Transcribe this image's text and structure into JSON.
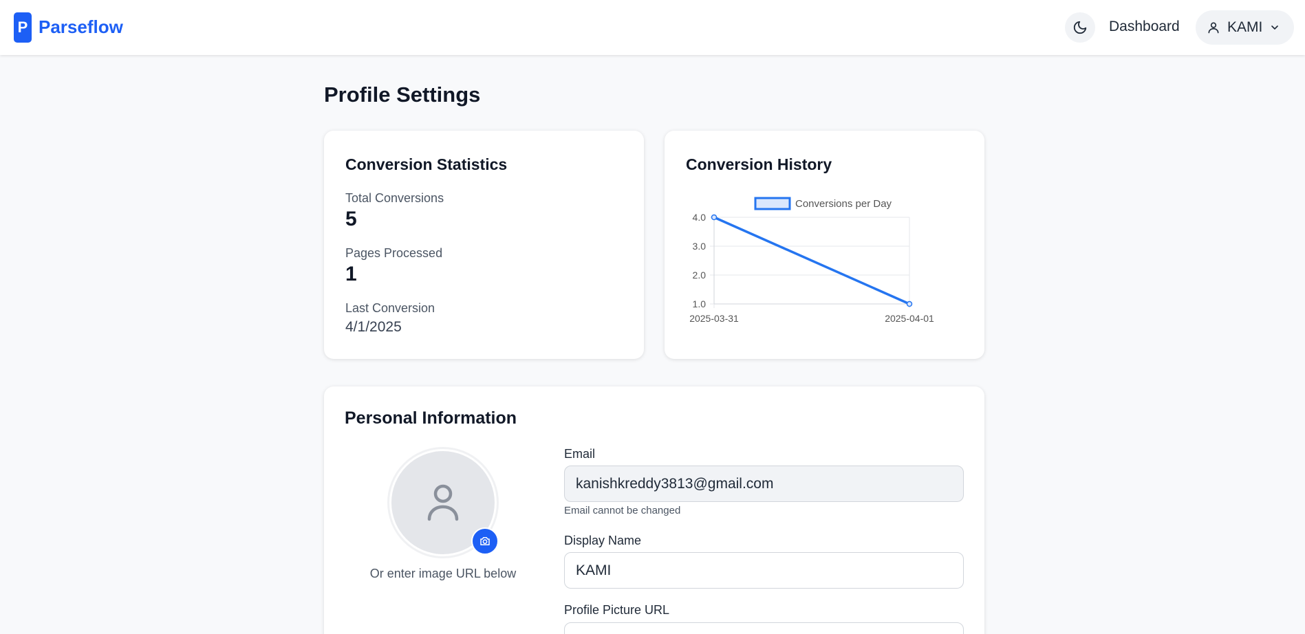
{
  "header": {
    "logo_letter": "P",
    "app_name": "Parseflow",
    "dashboard_link": "Dashboard",
    "user_name": "KAMI",
    "icons": {
      "theme": "moon-icon",
      "user": "user-icon",
      "chevron": "chevron-down-icon"
    }
  },
  "page": {
    "title": "Profile Settings"
  },
  "stats": {
    "title": "Conversion Statistics",
    "total_label": "Total Conversions",
    "total_value": "5",
    "pages_label": "Pages Processed",
    "pages_value": "1",
    "last_label": "Last Conversion",
    "last_value": "4/1/2025"
  },
  "history": {
    "title": "Conversion History"
  },
  "chart_data": {
    "type": "line",
    "x": [
      "2025-03-31",
      "2025-04-01"
    ],
    "series": [
      {
        "name": "Conversions per Day",
        "values": [
          4.0,
          1.0
        ]
      }
    ],
    "y_ticks": [
      "4.0",
      "3.0",
      "2.0",
      "1.0"
    ],
    "ylim": [
      1.0,
      4.0
    ],
    "grid": true,
    "legend": "top",
    "color": "#2575f0"
  },
  "personal": {
    "title": "Personal Information",
    "avatar_hint": "Or enter image URL below",
    "email_label": "Email",
    "email_value": "kanishkreddy3813@gmail.com",
    "email_hint": "Email cannot be changed",
    "display_label": "Display Name",
    "display_value": "KAMI",
    "picture_label": "Profile Picture URL",
    "picture_value": ""
  },
  "colors": {
    "brand": "#1d5ff5",
    "background": "#f8f9fb",
    "card": "#ffffff"
  }
}
